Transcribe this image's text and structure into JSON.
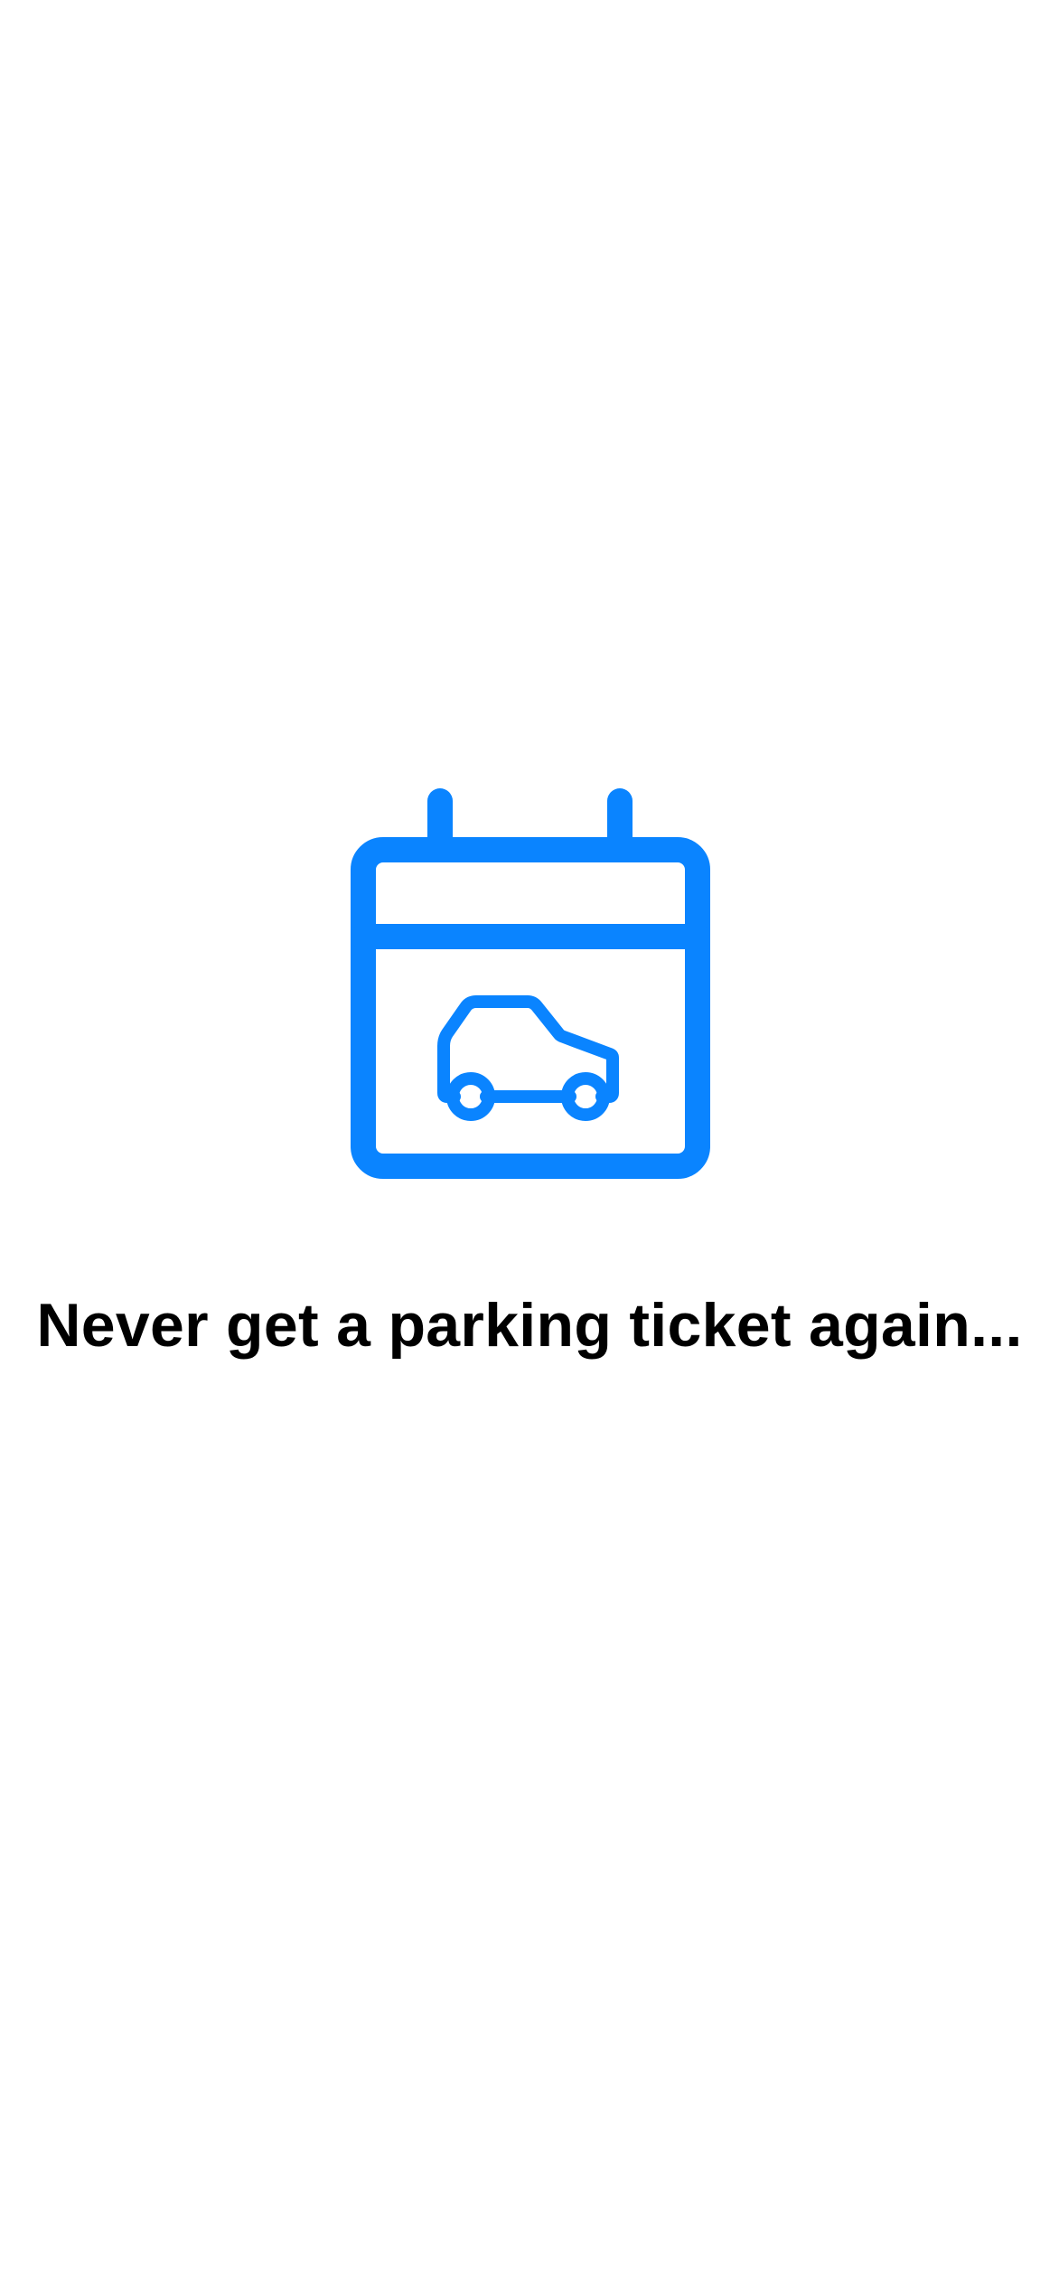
{
  "onboarding": {
    "icon": "calendar-car-icon",
    "headline": "Never get a parking ticket again..."
  },
  "colors": {
    "accent": "#0A84FF",
    "background": "#FFFFFF",
    "text": "#000000"
  }
}
